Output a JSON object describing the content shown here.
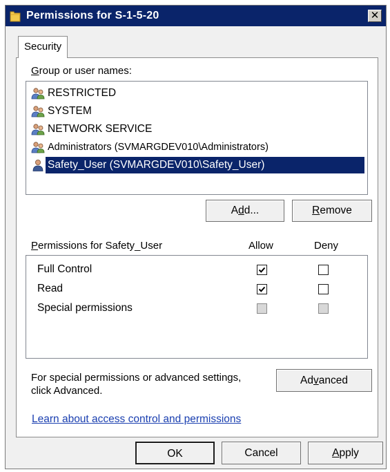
{
  "window": {
    "title": "Permissions for S-1-5-20",
    "close_glyph": "✕"
  },
  "tabs": [
    {
      "label": "Security",
      "active": true
    }
  ],
  "group_list": {
    "label_prefix": "",
    "label_hotkey": "G",
    "label_rest": "roup or user names:",
    "items": [
      {
        "name": "RESTRICTED",
        "icon": "group-icon",
        "selected": false
      },
      {
        "name": "SYSTEM",
        "icon": "group-icon",
        "selected": false
      },
      {
        "name": "NETWORK SERVICE",
        "icon": "group-icon",
        "selected": false
      },
      {
        "name": "Administrators (SVMARGDEV010\\Administrators)",
        "icon": "group-icon",
        "selected": true
      },
      {
        "name": "Safety_User (SVMARGDEV010\\Safety_User)",
        "icon": "user-icon",
        "selected": true
      }
    ]
  },
  "buttons": {
    "add": {
      "pre": "A",
      "hotkey": "d",
      "post": "d..."
    },
    "remove": {
      "pre": "",
      "hotkey": "R",
      "post": "emove"
    },
    "advanced": {
      "pre": "Ad",
      "hotkey": "v",
      "post": "anced"
    },
    "ok": "OK",
    "cancel": "Cancel",
    "apply": {
      "pre": "",
      "hotkey": "A",
      "post": "pply"
    }
  },
  "permissions": {
    "label_prefix": "",
    "label_hotkey": "P",
    "label_rest": "ermissions for Safety_User",
    "allow_header": "Allow",
    "deny_header": "Deny",
    "rows": [
      {
        "name": "Full Control",
        "allow": true,
        "deny": false,
        "disabled": false
      },
      {
        "name": "Read",
        "allow": true,
        "deny": false,
        "disabled": false
      },
      {
        "name": "Special permissions",
        "allow": false,
        "deny": false,
        "disabled": true
      }
    ]
  },
  "advanced_hint": {
    "line1": "For special permissions or advanced settings,",
    "line2": "click Advanced."
  },
  "help_link": "Learn about access control and permissions",
  "colors": {
    "titlebar": "#0a246a",
    "selection": "#0a246a",
    "link": "#1a3fb0"
  }
}
